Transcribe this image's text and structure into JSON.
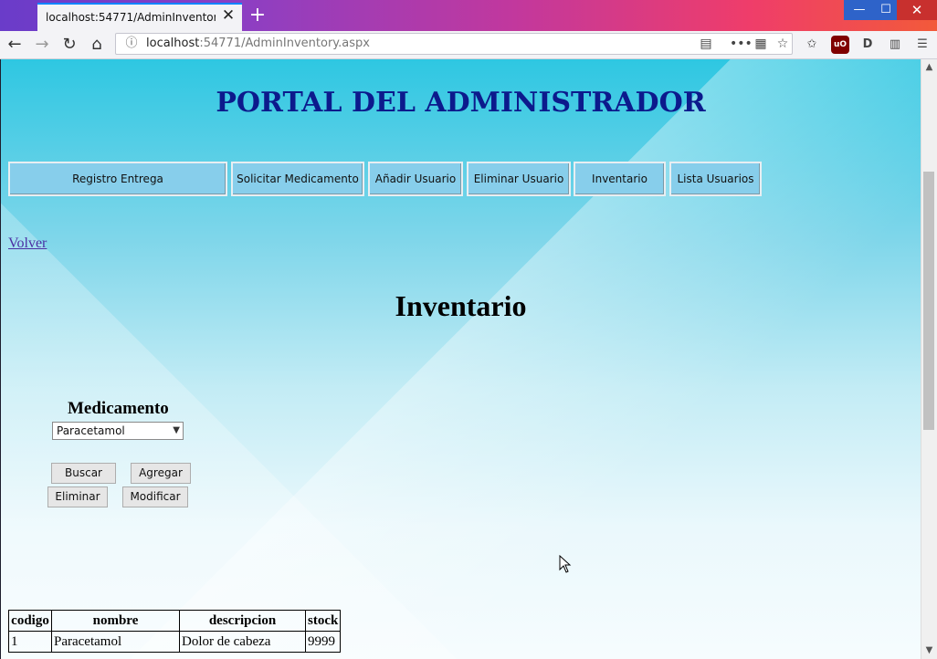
{
  "browser": {
    "tab_title": "localhost:54771/AdminInventory.aspx",
    "url_host": "localhost",
    "url_rest": ":54771/AdminInventory.aspx",
    "new_tab": "+",
    "tab_close": "✕",
    "window_controls": {
      "minimize": "—",
      "maximize": "☐",
      "close": "✕"
    }
  },
  "page": {
    "portal_title": "PORTAL DEL ADMINISTRADOR",
    "menu": [
      "Registro Entrega",
      "Solicitar Medicamento",
      "Añadir Usuario",
      "Eliminar Usuario",
      "Inventario",
      "Lista Usuarios"
    ],
    "volver": "Volver",
    "heading": "Inventario",
    "medicamento_label": "Medicamento",
    "medicamento_selected": "Paracetamol",
    "buttons": {
      "buscar": "Buscar",
      "agregar": "Agregar",
      "eliminar": "Eliminar",
      "modificar": "Modificar"
    },
    "table": {
      "headers": [
        "codigo",
        "nombre",
        "descripcion",
        "stock"
      ],
      "rows": [
        [
          "1",
          "Paracetamol",
          "Dolor de cabeza",
          "9999"
        ]
      ]
    }
  }
}
